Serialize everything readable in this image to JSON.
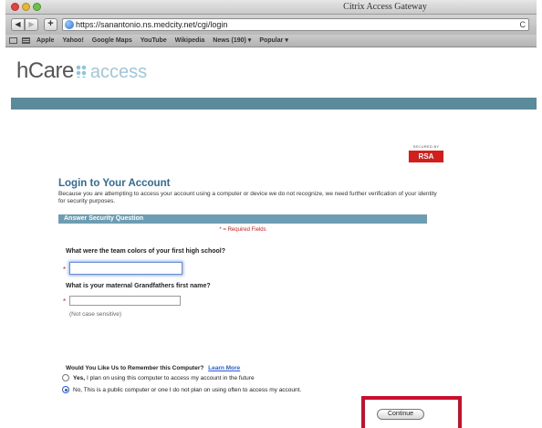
{
  "window": {
    "title": "Citrix Access Gateway"
  },
  "toolbar": {
    "back_glyph": "◀",
    "forward_glyph": "▶",
    "add_glyph": "+",
    "url": "https://sanantonio.ns.medcity.net/cgi/login",
    "reload_glyph": "C"
  },
  "bookmarks": {
    "items": [
      "Apple",
      "Yahoo!",
      "Google Maps",
      "YouTube",
      "Wikipedia",
      "News (190) ▾",
      "Popular ▾"
    ]
  },
  "logo": {
    "brand": "hCare",
    "product": "access"
  },
  "rsa": {
    "secured_by": "SECURED BY",
    "name": "RSA"
  },
  "login": {
    "title": "Login to Your Account",
    "intro": "Because you are attempting to access your account using a computer or device we do not recognize, we need further verification of your identity for security purposes.",
    "section_title": "Answer Security Question",
    "required_note": "* = Required Fields",
    "question1": "What were the team colors of your first high school?",
    "answer1_value": "",
    "question2": "What is your maternal Grandfathers first name?",
    "answer2_value": "",
    "required_marker": "*",
    "case_note": "(Not case sensitive)"
  },
  "remember": {
    "question": "Would You Like Us to Remember this Computer?",
    "learn_more": "Learn More",
    "option_yes_bold": "Yes,",
    "option_yes_text": "I plan on using this computer to access my account in the future",
    "option_no_text": "No, This is a public computer or one I do not plan on using often to access my account.",
    "selected": "no"
  },
  "actions": {
    "continue_label": "Continue"
  },
  "colors": {
    "teal_band": "#5b8a9a",
    "section_bar": "#6d9db2",
    "title_blue": "#2e6d9a",
    "highlight": "#c8102e",
    "rsa_red": "#d21f1b"
  }
}
